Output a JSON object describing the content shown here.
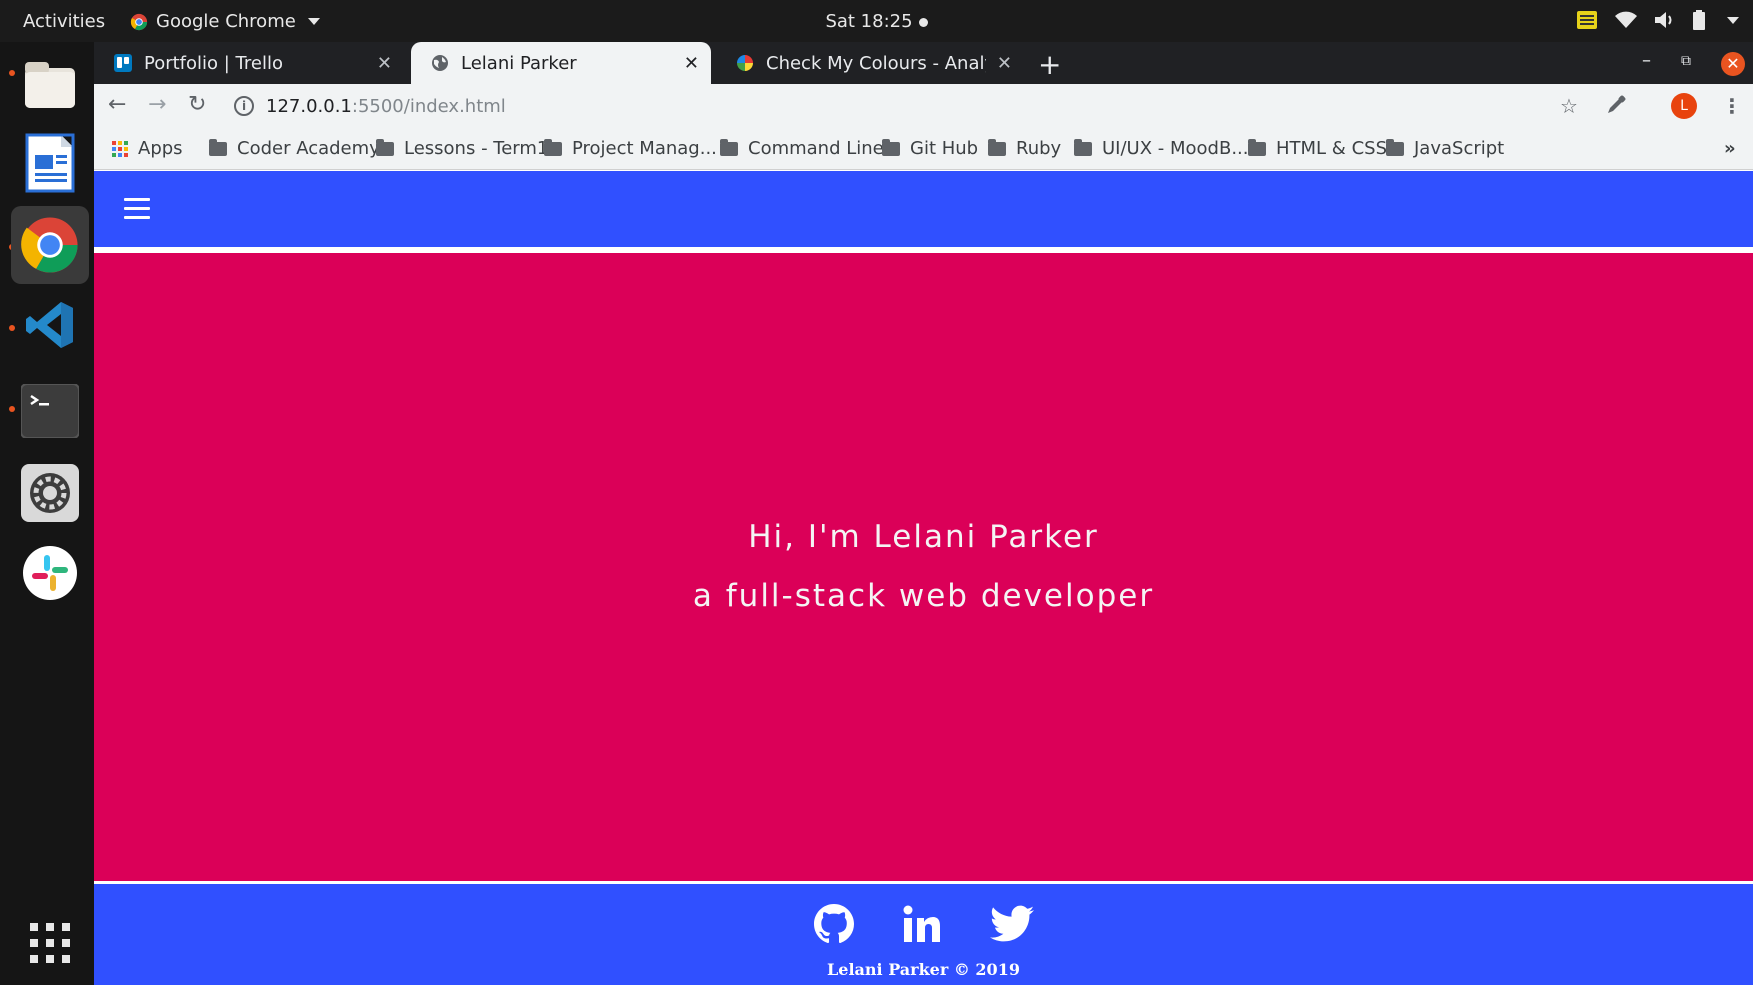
{
  "topbar": {
    "activities": "Activities",
    "app_name": "Google Chrome",
    "clock": "Sat 18:25"
  },
  "dock": {
    "items": [
      "files-icon",
      "libreoffice-writer-icon",
      "chrome-icon",
      "vscode-icon",
      "terminal-icon",
      "settings-icon",
      "slack-icon",
      "show-apps-icon"
    ]
  },
  "browser": {
    "tabs": [
      {
        "label": "Portfolio | Trello"
      },
      {
        "label": "Lelani Parker"
      },
      {
        "label": "Check My Colours - Analyse"
      }
    ],
    "url_host": "127.0.0.1",
    "url_path": ":5500/index.html",
    "info_glyph": "i",
    "avatar_letter": "L",
    "bookmarks": [
      {
        "label": "Apps"
      },
      {
        "label": "Coder Academy"
      },
      {
        "label": "Lessons - Term1"
      },
      {
        "label": "Project Manag..."
      },
      {
        "label": "Command Line"
      },
      {
        "label": "Git Hub"
      },
      {
        "label": "Ruby"
      },
      {
        "label": "UI/UX - MoodB..."
      },
      {
        "label": "HTML & CSS"
      },
      {
        "label": "JavaScript"
      }
    ],
    "overflow": "»"
  },
  "page": {
    "colors": {
      "nav": "#3050ff",
      "hero": "#db0058",
      "footer": "#3050ff"
    },
    "hero_line1": "Hi, I'm Lelani Parker",
    "hero_line2": "a full-stack web developer",
    "social": [
      "github-icon",
      "linkedin-icon",
      "twitter-icon"
    ],
    "copyright": "Lelani Parker © 2019"
  }
}
